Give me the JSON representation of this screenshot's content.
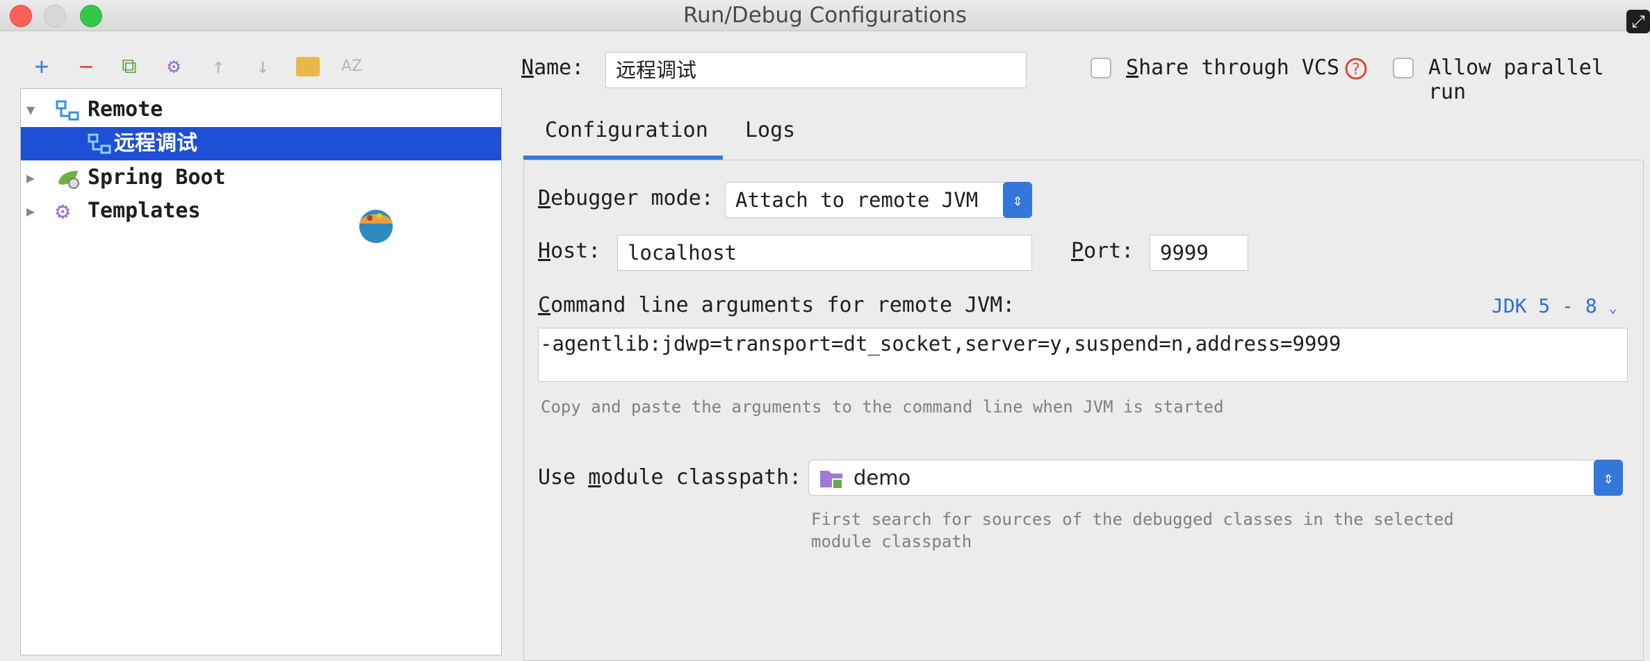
{
  "window": {
    "title": "Run/Debug Configurations"
  },
  "toolbar": {
    "items": [
      {
        "name": "add-icon",
        "glyph": "+",
        "color": "#3f86d6"
      },
      {
        "name": "remove-icon",
        "glyph": "−",
        "color": "#d9534f"
      },
      {
        "name": "copy-icon",
        "glyph": "⧉",
        "color": "#5aa041"
      },
      {
        "name": "gear-icon",
        "glyph": "⚙",
        "color": "#9b6ed6"
      },
      {
        "name": "arrow-up-icon",
        "glyph": "↑",
        "color": "#b5b5b5"
      },
      {
        "name": "arrow-down-icon",
        "glyph": "↓",
        "color": "#b5b5b5"
      },
      {
        "name": "folder-icon",
        "glyph": "▰",
        "color": "#e8b84a"
      },
      {
        "name": "sort-az-icon",
        "glyph": "AZ",
        "color": "#b5b5b5"
      }
    ]
  },
  "tree": {
    "items": [
      {
        "label": "Remote",
        "expanded": true,
        "icon": "remote-icon"
      },
      {
        "label": "远程调试",
        "selected": true,
        "icon": "remote-icon"
      },
      {
        "label": "Spring Boot",
        "expanded": false,
        "icon": "spring-boot-icon"
      },
      {
        "label": "Templates",
        "expanded": false,
        "icon": "gear-icon"
      }
    ]
  },
  "form": {
    "name_label_first": "N",
    "name_label_rest": "ame:",
    "name_value": "远程调试",
    "share_vcs_first": "S",
    "share_vcs_rest": "hare through VCS",
    "allow_parallel_label": "Allow parallel run"
  },
  "tabs": {
    "configuration": "Configuration",
    "logs": "Logs"
  },
  "config": {
    "debugger_mode_first": "D",
    "debugger_mode_rest": "ebugger mode:",
    "debugger_mode_value": "Attach to remote JVM",
    "host_first": "H",
    "host_rest": "ost:",
    "host_value": "localhost",
    "port_first": "P",
    "port_rest": "ort:",
    "port_value": "9999",
    "cmd_first": "C",
    "cmd_rest": "ommand line arguments for remote JVM:",
    "jdk_label": "JDK 5 - 8",
    "cmd_value": "-agentlib:jdwp=transport=dt_socket,server=y,suspend=n,address=9999",
    "cmd_hint": "Copy and paste the arguments to the command line when JVM is started",
    "module_pre": "Use ",
    "module_u": "m",
    "module_rest": "odule classpath:",
    "module_value": "demo",
    "module_hint_1": "First search for sources of the debugged classes in the selected",
    "module_hint_2": "module classpath"
  },
  "colors": {
    "selection": "#1f4fd6",
    "link": "#2f6fc8",
    "tab_underline": "#3a7bd5",
    "help": "#e0453b"
  }
}
